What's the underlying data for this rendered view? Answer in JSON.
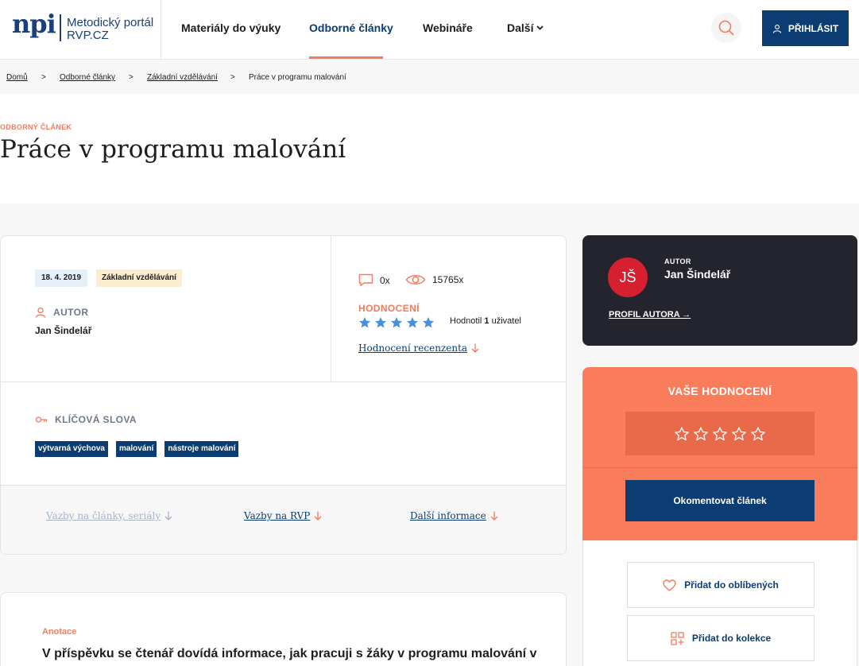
{
  "header": {
    "logo_mark": "npi",
    "logo_line1": "Metodický portál",
    "logo_line2": "RVP.CZ",
    "nav": [
      {
        "label": "Materiály do výuky"
      },
      {
        "label": "Odborné články"
      },
      {
        "label": "Webináře"
      },
      {
        "label": "Další"
      }
    ],
    "login_label": "PŘIHLÁSIT"
  },
  "breadcrumb": {
    "items": [
      "Domů",
      "Odborné články",
      "Základní vzdělávání",
      "Práce v programu malování"
    ],
    "separator": ">"
  },
  "article": {
    "kicker": "ODBORNÝ ČLÁNEK",
    "title": "Práce v programu malování",
    "date": "18. 4. 2019",
    "level": "Základní vzdělávání",
    "author_label": "AUTOR",
    "author_name": "Jan Šindelář",
    "comments": "0x",
    "views": "15765x",
    "rating_label": "HODNOCENÍ",
    "rating_value": 5,
    "rating_note_prefix": "Hodnotil",
    "rating_note_count": "1",
    "rating_note_suffix": "uživatel",
    "review_link": "Hodnocení recenzenta",
    "keywords_label": "KLÍČOVÁ SLOVA",
    "keywords": [
      "výtvarná výchova",
      "malování",
      "nástroje malování"
    ],
    "bottom_links": [
      "Vazby na články, seriály",
      "Vazby na RVP",
      "Další informace"
    ]
  },
  "annotation": {
    "label": "Anotace",
    "text": "V příspěvku se čtenář dovídá informace, jak pracuji s žáky v programu malování v"
  },
  "author_card": {
    "initials": "JŠ",
    "label": "AUTOR",
    "name": "Jan Šindelář",
    "profile_link": "PROFIL AUTORA →"
  },
  "your_rating": {
    "title": "VAŠE HODNOCENÍ",
    "comment_button": "Okomentovat článek",
    "favorite_button": "Přidat do oblíbených",
    "collection_button": "Přidat do kolekce"
  },
  "colors": {
    "primary": "#0b3d73",
    "accent": "#f47a5a",
    "star": "#4a90d9",
    "dark": "#23242d"
  }
}
